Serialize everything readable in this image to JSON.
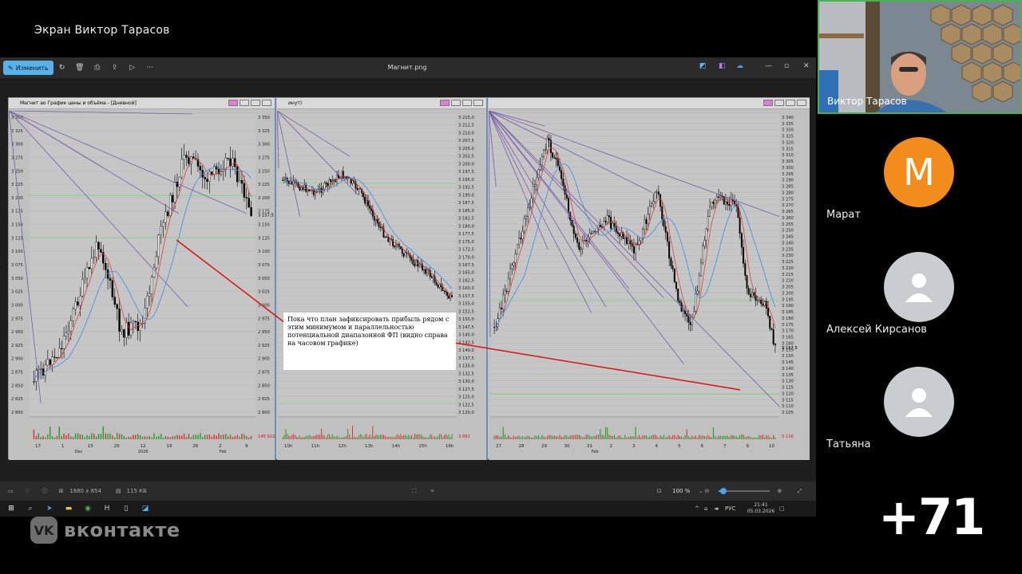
{
  "share_title": "Экран Виктор Тарасов",
  "viewer": {
    "edit_label": "Изменить",
    "file_name": "Магнит.png",
    "zoom": "100 %",
    "dimensions": "1880 x 854",
    "file_size": "115 КБ"
  },
  "panes": [
    {
      "title": "Магнит ao График цены и объёма - [Дневной]",
      "y_ticks": [
        "3 350",
        "3 325",
        "3 300",
        "3 275",
        "3 250",
        "3 225",
        "3 200",
        "3 175",
        "3 150",
        "3 125",
        "3 100",
        "3 075",
        "3 050",
        "3 025",
        "3 000",
        "2 975",
        "2 950",
        "2 925",
        "2 900",
        "2 875",
        "2 850",
        "2 825",
        "2 800"
      ],
      "last_price": "3 157,5",
      "volume_value": "145 922",
      "x_ticks": [
        "17",
        "1",
        "15",
        "29",
        "12",
        "19",
        "26",
        "2",
        "9"
      ],
      "x_sub": [
        "Dec",
        "2026",
        "Feb"
      ]
    },
    {
      "title": "инут)",
      "y_ticks": [
        "3 215,0",
        "3 212,5",
        "3 210,0",
        "3 207,5",
        "3 205,0",
        "3 202,5",
        "3 200,0",
        "3 197,5",
        "3 195,0",
        "3 192,5",
        "3 190,0",
        "3 187,5",
        "3 185,0",
        "3 182,5",
        "3 180,0",
        "3 177,5",
        "3 175,0",
        "3 172,5",
        "3 170,0",
        "3 167,5",
        "3 165,0",
        "3 162,5",
        "3 160,0",
        "3 157,5",
        "3 155,0",
        "3 152,5",
        "3 150,0",
        "3 147,5",
        "3 145,0",
        "3 142,5",
        "3 140,0",
        "3 137,5",
        "3 135,0",
        "3 132,5",
        "3 130,0",
        "3 127,5",
        "3 125,0",
        "3 122,5",
        "3 120,0"
      ],
      "volume_value": "3 891",
      "x_ticks": [
        "10h",
        "11h",
        "12h",
        "13h",
        "14h",
        "15h",
        "16h"
      ]
    },
    {
      "title": "",
      "y_ticks": [
        "3 340",
        "3 335",
        "3 330",
        "3 325",
        "3 320",
        "3 315",
        "3 310",
        "3 305",
        "3 300",
        "3 295",
        "3 290",
        "3 285",
        "3 280",
        "3 275",
        "3 270",
        "3 265",
        "3 260",
        "3 255",
        "3 250",
        "3 245",
        "3 240",
        "3 235",
        "3 230",
        "3 225",
        "3 220",
        "3 215",
        "3 210",
        "3 205",
        "3 200",
        "3 195",
        "3 190",
        "3 185",
        "3 180",
        "3 175",
        "3 170",
        "3 165",
        "3 160",
        "3 155",
        "3 150",
        "3 145",
        "3 140",
        "3 135",
        "3 130",
        "3 125",
        "3 120",
        "3 115",
        "3 110",
        "3 105"
      ],
      "last_price": "3 157,5",
      "volume_value": "5 116",
      "x_ticks": [
        "27",
        "28",
        "29",
        "30",
        "31",
        "2",
        "3",
        "4",
        "5",
        "6",
        "7",
        "9",
        "10"
      ],
      "x_sub": [
        "Feb"
      ]
    }
  ],
  "note_text": "Пока что план зафиксировать прибыль рядом с этим минимумом и параллельностью потенциальной диапазонной ФП (видно справа на часовом графике)",
  "taskbar": {
    "lang": "РУС",
    "time": "21:41",
    "date": "05.03.2026"
  },
  "brand": "вконтакте",
  "camera_name": "Виктор Тарасов",
  "participants": [
    {
      "name": "Марат",
      "initial": "М",
      "color": "#f28c1c"
    },
    {
      "name": "Алексей Кирсанов",
      "initial": "",
      "color": "#c9ccd1"
    },
    {
      "name": "Татьяна",
      "initial": "",
      "color": "#c9ccd1"
    }
  ],
  "more_count": "+71"
}
